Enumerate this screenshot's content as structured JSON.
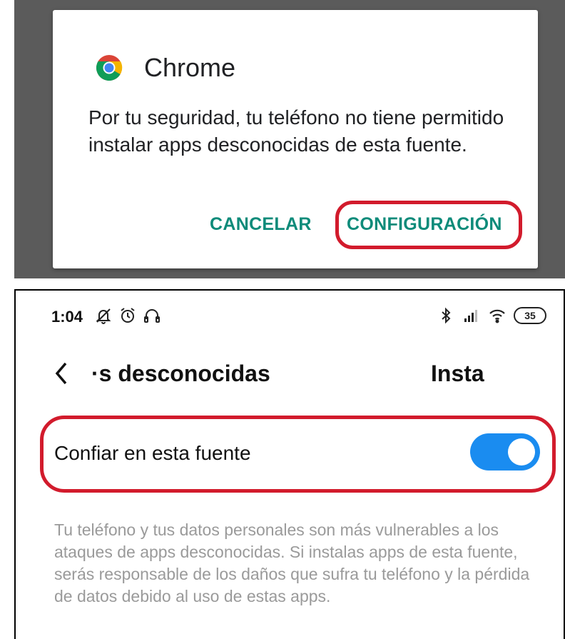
{
  "dialog": {
    "app_name": "Chrome",
    "app_icon": "chrome-icon",
    "message": "Por tu seguridad, tu teléfono no tiene permitido instalar apps desconocidas de esta fuente.",
    "cancel_label": "CANCELAR",
    "settings_label": "CONFIGURACIÓN",
    "button_color": "#0e8b7a",
    "highlight_color": "#d21b2c"
  },
  "status_bar": {
    "time": "1:04",
    "left_icons": [
      "notifications-off-icon",
      "alarm-icon",
      "headphones-icon"
    ],
    "right_icons": [
      "bluetooth-icon",
      "signal-icon",
      "wifi-icon"
    ],
    "battery": "35"
  },
  "header": {
    "back_icon": "chevron-left-icon",
    "title_left": "·s desconocidas",
    "title_right": "Insta"
  },
  "trust_setting": {
    "label": "Confiar en esta fuente",
    "enabled": true,
    "toggle_color": "#1a8cf0"
  },
  "warning": "Tu teléfono y tus datos personales son más vulnerables a los ataques de apps desconocidas. Si instalas apps de esta fuente, serás responsable de los daños que sufra tu teléfono y la pérdida de datos debido al uso de estas apps."
}
